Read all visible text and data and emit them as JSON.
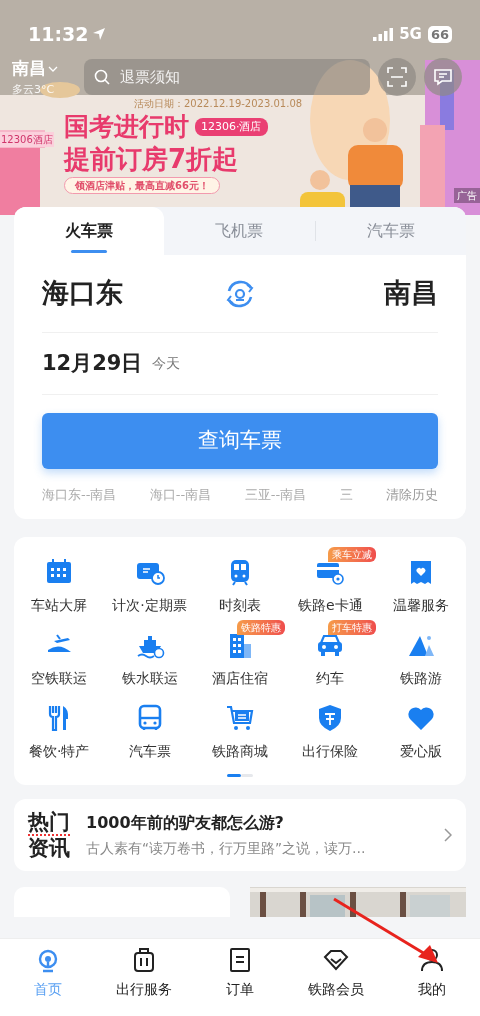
{
  "status_bar": {
    "time": "11:32",
    "network": "5G",
    "battery": "66"
  },
  "header": {
    "city": "南昌",
    "weather": "多云3°C",
    "search_placeholder": "退票须知"
  },
  "banner": {
    "date": "活动日期：2022.12.19-2023.01.08",
    "line1": "国考进行时",
    "tag": "12306·酒店",
    "line2": "提前订房7折起",
    "subtitle": "领酒店津贴，最高直减66元！",
    "sign": "12306酒店",
    "ad_label": "广告"
  },
  "tabs": [
    {
      "label": "火车票",
      "selected": true
    },
    {
      "label": "飞机票",
      "selected": false
    },
    {
      "label": "汽车票",
      "selected": false
    }
  ],
  "trip": {
    "from": "海口东",
    "to": "南昌",
    "date": "12月29日",
    "day": "今天",
    "search_button": "查询车票"
  },
  "history": [
    "海口东--南昌",
    "海口--南昌",
    "三亚--南昌",
    "三"
  ],
  "clear_history": "清除历史",
  "services": [
    {
      "label": "车站大屏"
    },
    {
      "label": "计次·定期票"
    },
    {
      "label": "时刻表"
    },
    {
      "label": "铁路e卡通",
      "badge": "乘车立减"
    },
    {
      "label": "温馨服务"
    },
    {
      "label": "空铁联运"
    },
    {
      "label": "铁水联运"
    },
    {
      "label": "酒店住宿",
      "badge": "铁路特惠"
    },
    {
      "label": "约车",
      "badge": "打车特惠"
    },
    {
      "label": "铁路游"
    },
    {
      "label": "餐饮·特产"
    },
    {
      "label": "汽车票"
    },
    {
      "label": "铁路商城"
    },
    {
      "label": "出行保险"
    },
    {
      "label": "爱心版"
    }
  ],
  "news": {
    "logo_top": "热门",
    "logo_bottom": "资讯",
    "title": "1000年前的驴友都怎么游?",
    "summary": "古人素有“读万卷书，行万里路”之说，读万…"
  },
  "bottom_nav": [
    {
      "label": "首页",
      "selected": true
    },
    {
      "label": "出行服务",
      "selected": false
    },
    {
      "label": "订单",
      "selected": false
    },
    {
      "label": "铁路会员",
      "selected": false
    },
    {
      "label": "我的",
      "selected": false
    }
  ]
}
